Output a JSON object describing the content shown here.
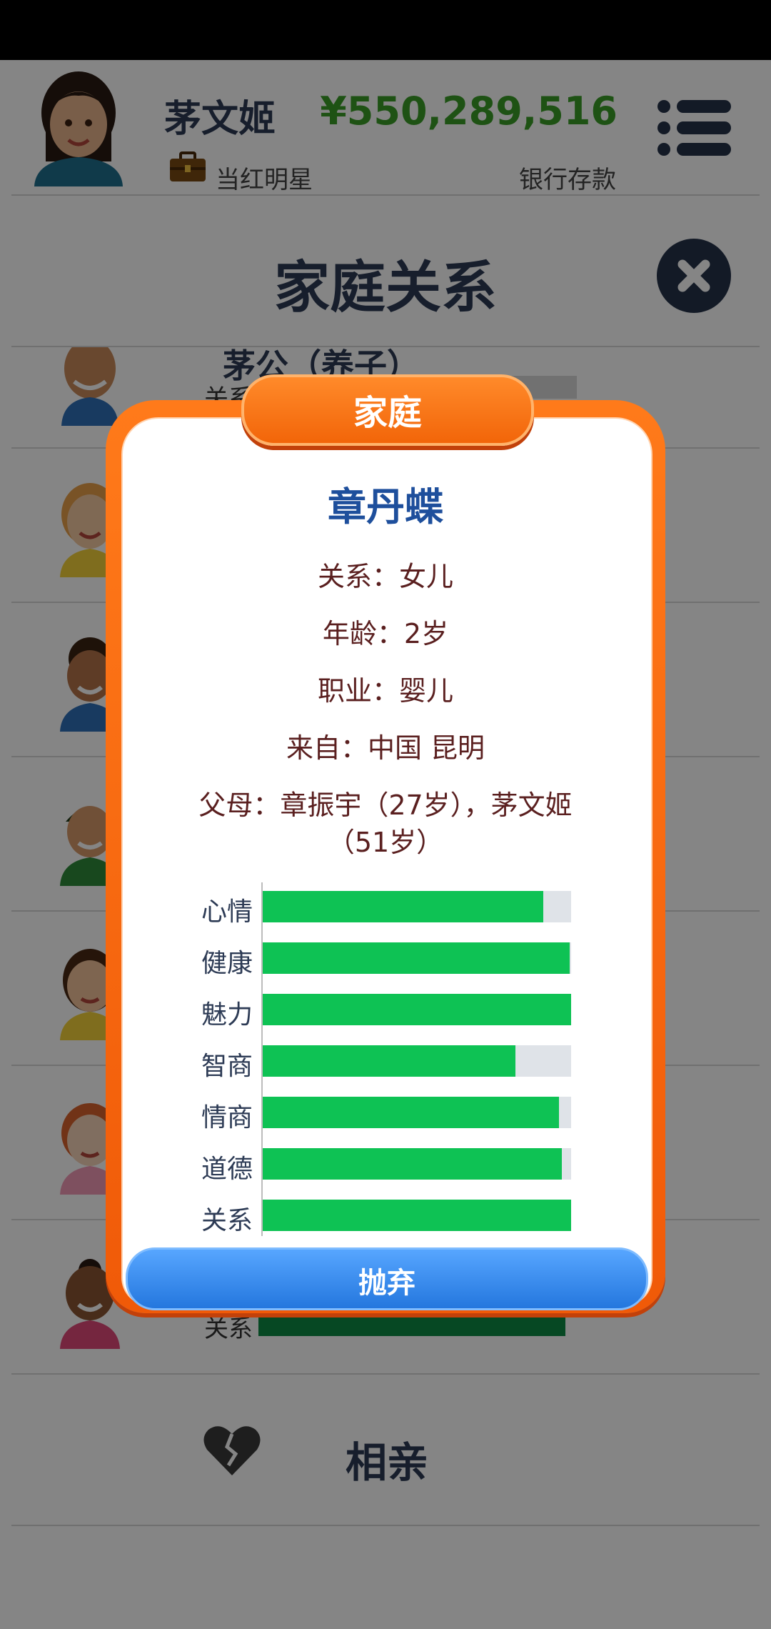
{
  "header": {
    "player_name": "茅文姬",
    "job": "当红明星",
    "money": "¥550,289,516",
    "money_label": "银行存款"
  },
  "page_title": "家庭关系",
  "list": {
    "partial_row_name": "茅公（养子）",
    "partial_row_label": "关系",
    "last_row_label": "关系"
  },
  "dating": {
    "label": "相亲",
    "icon": "heart-broken-icon"
  },
  "modal": {
    "tab_title": "家庭",
    "name": "章丹蝶",
    "relation": "关系：女儿",
    "age": "年龄：2岁",
    "occupation": "职业：婴儿",
    "origin": "来自：中国 昆明",
    "parents_line1": "父母：章振宇（27岁），茅文姬",
    "parents_line2": "（51岁）",
    "stats": [
      {
        "label": "心情",
        "value": 0.91
      },
      {
        "label": "健康",
        "value": 0.995
      },
      {
        "label": "魅力",
        "value": 1.0
      },
      {
        "label": "智商",
        "value": 0.82
      },
      {
        "label": "情商",
        "value": 0.96
      },
      {
        "label": "道德",
        "value": 0.97
      },
      {
        "label": "关系",
        "value": 1.0
      }
    ],
    "abandon_label": "抛弃"
  },
  "colors": {
    "accent_orange": "#f26509",
    "stat_green": "#0ec254",
    "button_blue": "#2f86ea",
    "title_blue": "#1e4f9c",
    "money_green": "#3a9d28"
  }
}
